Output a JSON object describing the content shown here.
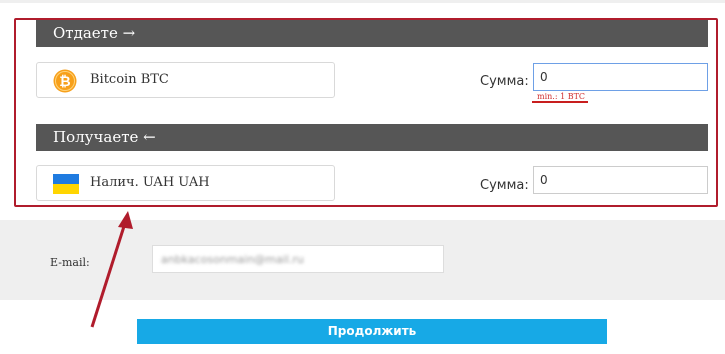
{
  "give": {
    "header": "Отдаете →",
    "currency": "Bitcoin BTC",
    "currency_icon": "bitcoin-icon",
    "sum_label": "Сумма:",
    "sum_value": "0",
    "min_note": "min.: 1 BTC"
  },
  "receive": {
    "header": "Получаете ←",
    "currency": "Налич. UAH UAH",
    "currency_icon": "ukraine-flag-icon",
    "sum_label": "Сумма:",
    "sum_value": "0"
  },
  "email": {
    "label": "E-mail:",
    "value": "anbkacosonmain@mail.ru"
  },
  "submit_label": "Продолжить",
  "colors": {
    "section_header": "#565656",
    "accent_button": "#17a9e6",
    "highlight": "#b01c2c",
    "error": "#d03030"
  }
}
